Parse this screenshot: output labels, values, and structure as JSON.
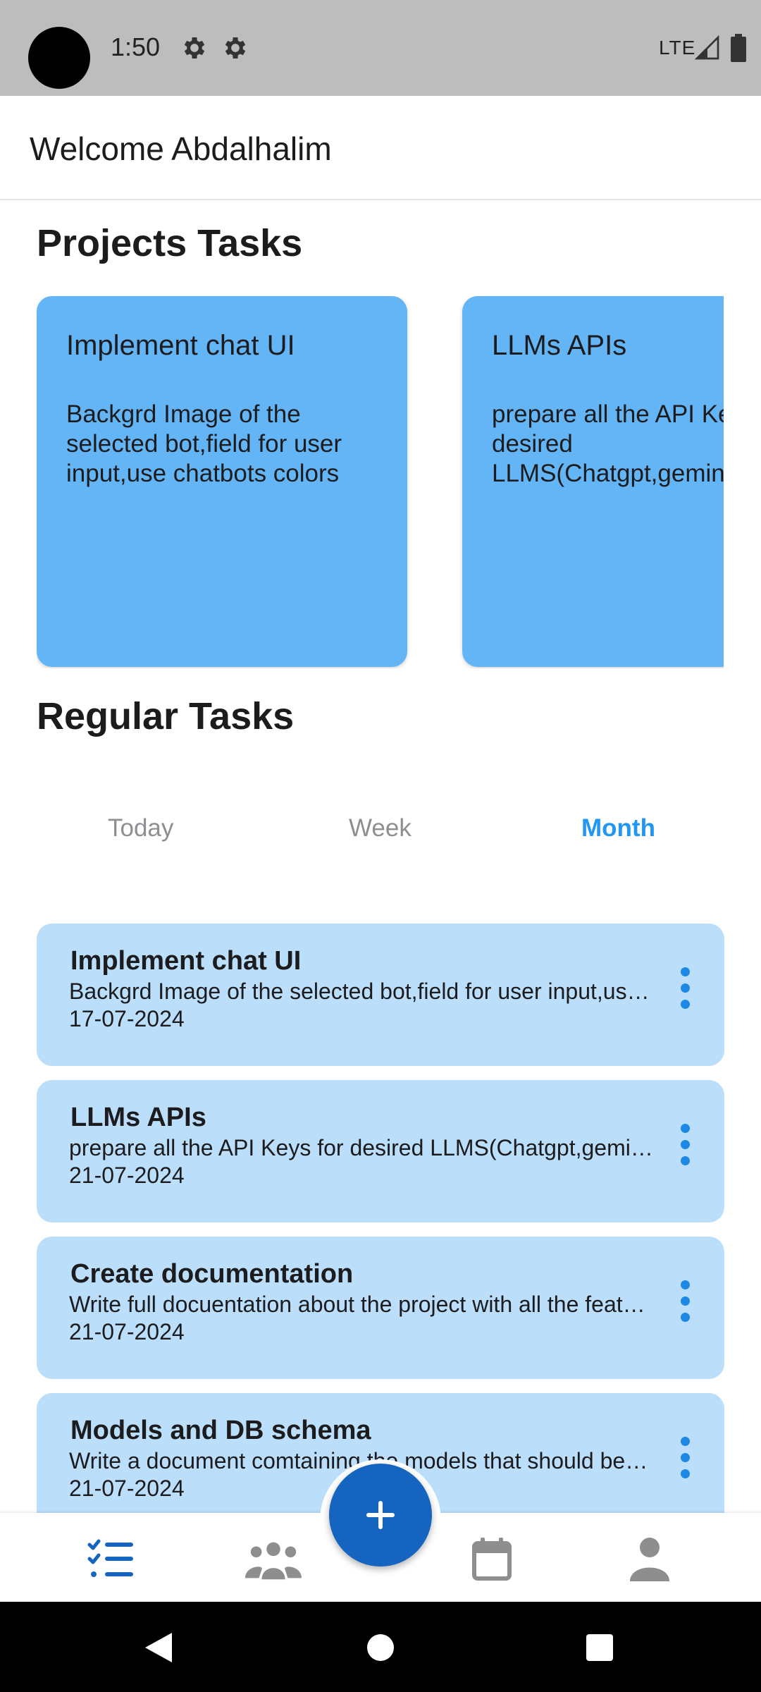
{
  "status_bar": {
    "time": "1:50",
    "network": "LTE",
    "icons": [
      "gear-icon",
      "gear-icon",
      "signal-icon",
      "battery-icon"
    ]
  },
  "header": {
    "welcome": "Welcome Abdalhalim"
  },
  "projects": {
    "title": "Projects Tasks",
    "cards": [
      {
        "title": "Implement chat UI",
        "description": "Backgrd Image of the selected bot,field for user input,use chatbots colors"
      },
      {
        "title": "LLMs APIs",
        "description": "prepare all the API Keys for desired LLMS(Chatgpt,gemini,claudeAI,FlowGPT"
      }
    ]
  },
  "regular": {
    "title": "Regular Tasks",
    "tabs": [
      {
        "label": "Today",
        "active": false
      },
      {
        "label": "Week",
        "active": false
      },
      {
        "label": "Month",
        "active": true
      }
    ],
    "tasks": [
      {
        "title": "Implement chat UI",
        "description": "Backgrd Image of the selected bot,field for user input,use chatbots colors",
        "date": "17-07-2024"
      },
      {
        "title": "LLMs APIs",
        "description": "prepare all the API Keys for desired LLMS(Chatgpt,gemini,claudeAI,FlowGPT",
        "date": "21-07-2024"
      },
      {
        "title": "Create documentation",
        "description": "Write full docuentation about the project with all the features",
        "date": "21-07-2024"
      },
      {
        "title": "Models and DB schema",
        "description": "Write a document comtaining the models that should be used",
        "date": "21-07-2024"
      }
    ]
  },
  "bottom_nav": {
    "items": [
      "checklist-icon",
      "group-icon",
      "calendar-icon",
      "person-icon"
    ],
    "fab_icon": "plus-icon"
  },
  "colors": {
    "accent": "#2196f3",
    "project_card": "#64b5f6",
    "task_card": "#bbdefb",
    "fab": "#1565c0"
  }
}
